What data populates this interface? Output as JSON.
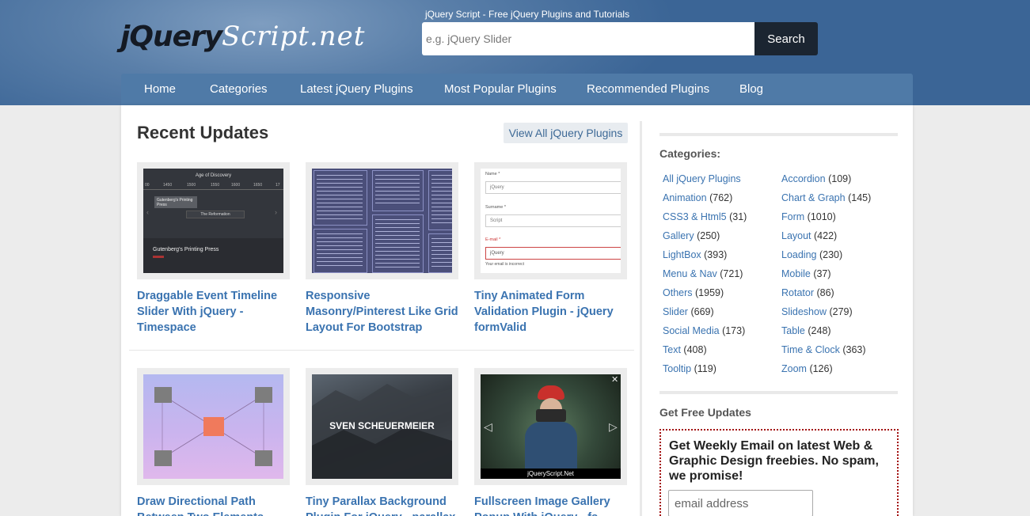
{
  "header": {
    "logo_part1": "jQuery",
    "logo_part2": "Script.net",
    "tagline": "jQuery Script - Free jQuery Plugins and Tutorials",
    "search_placeholder": "e.g. jQuery Slider",
    "search_button": "Search"
  },
  "nav": [
    "Home",
    "Categories",
    "Latest jQuery Plugins",
    "Most Popular Plugins",
    "Recommended Plugins",
    "Blog"
  ],
  "main": {
    "title": "Recent Updates",
    "view_all": "View All jQuery Plugins",
    "cards": [
      {
        "title": "Draggable Event Timeline Slider With jQuery - Timespace"
      },
      {
        "title": "Responsive Masonry/Pinterest Like Grid Layout For Bootstrap"
      },
      {
        "title": "Tiny Animated Form Validation Plugin - jQuery formValid"
      },
      {
        "title": "Draw Directional Path Between Two Elements"
      },
      {
        "title": "Tiny Parallax Background Plugin For jQuery - parallax"
      },
      {
        "title": "Fullscreen Image Gallery Popup With jQuery - fs-gallery"
      }
    ],
    "thumb_text": {
      "timeline_title": "Age of Discovery",
      "timeline_years": [
        "00",
        "1450",
        "1500",
        "1550",
        "1600",
        "1650",
        "17"
      ],
      "timeline_event": "Gutenberg's Printing Press",
      "timeline_reformation": "The Reformation",
      "timeline_footer": "Gutenberg's Printing Press",
      "form_name_label": "Name *",
      "form_name_value": "jQuery",
      "form_surname_label": "Surname *",
      "form_surname_value": "Script",
      "form_email_label": "E-mail *",
      "form_email_value": "jQuery",
      "form_error": "Your email is incorrect",
      "parallax_text": "SVEN SCHEUERMEIER",
      "gallery_caption": "jQueryScript.Net"
    }
  },
  "sidebar": {
    "categories_label": "Categories:",
    "categories_left": [
      {
        "name": "All jQuery Plugins",
        "count": ""
      },
      {
        "name": "Animation",
        "count": "(762)"
      },
      {
        "name": "CSS3 & Html5",
        "count": "(31)"
      },
      {
        "name": "Gallery",
        "count": "(250)"
      },
      {
        "name": "LightBox",
        "count": "(393)"
      },
      {
        "name": "Menu & Nav",
        "count": "(721)"
      },
      {
        "name": "Others",
        "count": "(1959)"
      },
      {
        "name": "Slider",
        "count": "(669)"
      },
      {
        "name": "Social Media",
        "count": "(173)"
      },
      {
        "name": "Text",
        "count": "(408)"
      },
      {
        "name": "Tooltip",
        "count": "(119)"
      }
    ],
    "categories_right": [
      {
        "name": "Accordion",
        "count": "(109)"
      },
      {
        "name": "Chart & Graph",
        "count": "(145)"
      },
      {
        "name": "Form",
        "count": "(1010)"
      },
      {
        "name": "Layout",
        "count": "(422)"
      },
      {
        "name": "Loading",
        "count": "(230)"
      },
      {
        "name": "Mobile",
        "count": "(37)"
      },
      {
        "name": "Rotator",
        "count": "(86)"
      },
      {
        "name": "Slideshow",
        "count": "(279)"
      },
      {
        "name": "Table",
        "count": "(248)"
      },
      {
        "name": "Time & Clock",
        "count": "(363)"
      },
      {
        "name": "Zoom",
        "count": "(126)"
      }
    ],
    "updates_label": "Get Free Updates",
    "subscribe_text": "Get Weekly Email on latest Web & Graphic Design freebies. No spam, we promise!",
    "email_placeholder": "email address"
  }
}
